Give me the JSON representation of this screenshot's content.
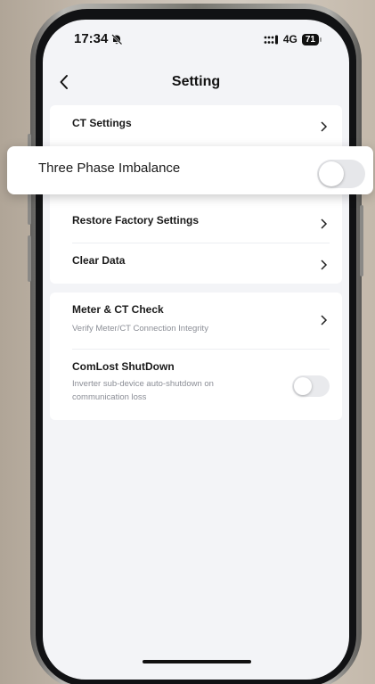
{
  "status_bar": {
    "time": "17:34",
    "network": "4G",
    "battery": "71"
  },
  "header": {
    "title": "Setting"
  },
  "group1": {
    "ct_settings": "CT Settings",
    "restore_factory": "Restore Factory Settings",
    "clear_data": "Clear Data"
  },
  "group2": {
    "meter_check": {
      "title": "Meter & CT Check",
      "subtitle": "Verify Meter/CT Connection Integrity"
    },
    "comlost": {
      "title": "ComLost ShutDown",
      "subtitle": "Inverter sub-device auto-shutdown on communication loss",
      "enabled": false
    }
  },
  "highlight": {
    "title": "Three Phase Imbalance",
    "enabled": false
  },
  "colors": {
    "accent_bg": "#f3f4f7",
    "toggle_off": "#e9eaed",
    "text": "#1a1a1a",
    "subtext": "#8b8e96"
  }
}
